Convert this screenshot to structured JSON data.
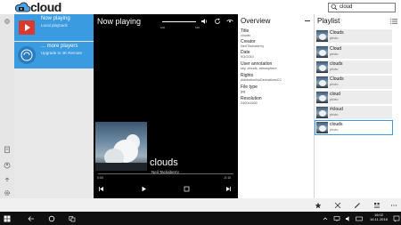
{
  "app": {
    "logo_text": "cloud"
  },
  "search": {
    "value": "cloud"
  },
  "players": [
    {
      "title": "Now playing",
      "subtitle": "Local playback"
    },
    {
      "title": "... more players",
      "subtitle": "Upgrade to 4K Remote"
    }
  ],
  "now_playing": {
    "title": "Now playing",
    "volume_min": "100",
    "volume_max": "100",
    "song": "clouds",
    "artist": "Neil Tackaberry",
    "time_elapsed": "0:00",
    "time_remaining": "-0:10"
  },
  "overview": {
    "title": "Overview",
    "fields": [
      {
        "label": "Title",
        "value": "clouds"
      },
      {
        "label": "Creator",
        "value": "Neil Tackaberry"
      },
      {
        "label": "Date",
        "value": "9/3/2010"
      },
      {
        "label": "User annotation",
        "value": "sky, clouds, atmosphere"
      },
      {
        "label": "Rights",
        "value": "AttributionNoDerivativesCC"
      },
      {
        "label": "File type",
        "value": "jpg"
      },
      {
        "label": "Resolution",
        "value": "2400x1600"
      }
    ]
  },
  "playlist": {
    "title": "Playlist",
    "items": [
      {
        "name": "Clouds",
        "type": "photo"
      },
      {
        "name": "Cloud",
        "type": "photo"
      },
      {
        "name": "clouds",
        "type": "photo"
      },
      {
        "name": "Clouds",
        "type": "photo"
      },
      {
        "name": "cloud",
        "type": "photo"
      },
      {
        "name": "#cloud",
        "type": "photo"
      },
      {
        "name": "clouds",
        "type": "photo"
      }
    ]
  },
  "taskbar": {
    "time": "16:02",
    "date": "16.11.2018"
  },
  "colors": {
    "accent": "#3a9be0",
    "now_playing_bg": "#000000",
    "taskbar_bg": "#101010"
  }
}
